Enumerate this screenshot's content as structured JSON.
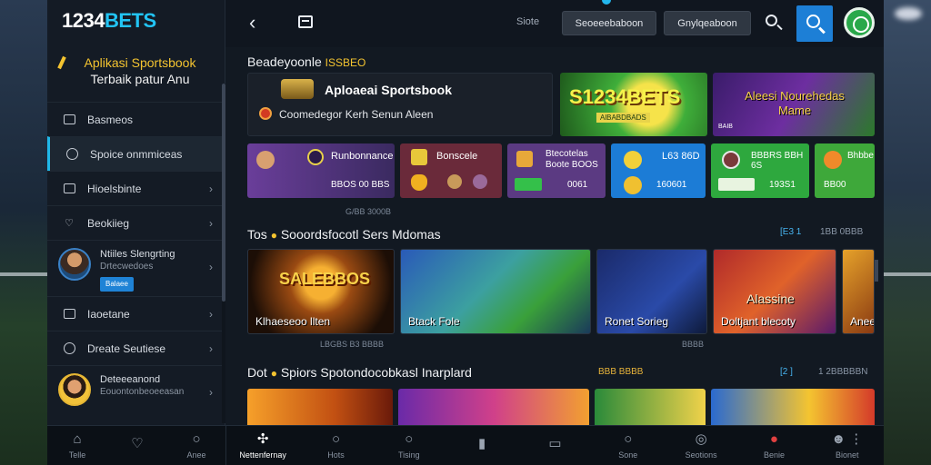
{
  "sidebar": {
    "logo_prefix": "1234",
    "logo_suffix": "BETS",
    "promo_line1": "Aplikasi Sportsbook",
    "promo_line2": "Terbaik patur Anu",
    "items": [
      {
        "label": "Basmeos"
      },
      {
        "label": "Spoice onmmiceas"
      },
      {
        "label": "Hioelsbinte"
      },
      {
        "label": "Beokiieg"
      }
    ],
    "user1": {
      "name": "Ntiiles Slengrting",
      "sub": "Drtecwedoes",
      "tag": "Balaee"
    },
    "items2": [
      {
        "label": "Iaoetane"
      },
      {
        "label": "Dreate Seutiese"
      }
    ],
    "user2": {
      "name": "Deteeeanond",
      "sub": "Eouontonbeoeeasan"
    }
  },
  "topbar": {
    "link": "Siote",
    "pill1": "Seoeeebaboon",
    "pill2": "Gnylqeaboon"
  },
  "main": {
    "section1": {
      "title": "Beadeyoonle",
      "badge": "ISSBEO"
    },
    "hero1": {
      "title": "Aploaeai Sportsbook",
      "subtitle": "Coomedegor Kerh Senun Aleen"
    },
    "hero2": {
      "title": "S1234BETS",
      "small": "AlBABDBADS"
    },
    "hero3": {
      "title": "Aleesi Nourehedas Mame",
      "small": "BAIB"
    },
    "tiles": [
      {
        "title": "Runbonnance",
        "value": "BBOS 00 BBS"
      },
      {
        "title": "Bonscele",
        "value": ""
      },
      {
        "title": "Btecotelas Boote BOOS",
        "value": "0061"
      },
      {
        "title": "L63 86D",
        "value": "160601"
      },
      {
        "title": "BBBRS BBH 6S",
        "value": "193S1"
      },
      {
        "title": "Bhbbe",
        "value": "BB00"
      }
    ],
    "under_tiles": "G/BB 3000B",
    "section2": {
      "title": "Tos",
      "title2": "Sooordsfocotl Sers Mdomas",
      "meta1": "[E3 1",
      "meta2": "1BB 0BBB"
    },
    "games": [
      {
        "label": "Klhaeseoo llten",
        "art": "SALEBBOS"
      },
      {
        "label": "Btack Fole"
      },
      {
        "label": "Ronet Sorieg"
      },
      {
        "label": "Doltjant blecoty",
        "art": "Alassine"
      },
      {
        "label": "Anee"
      }
    ],
    "under_games1": "LBGBS B3 BBBB",
    "under_games2": "BBBB",
    "section3": {
      "title": "Dot",
      "title2": "Spiors Spotondocobkasl Inarplard",
      "meta1": "BBB BBBB",
      "meta2": "[2 ]",
      "meta3": "1 2BBBBBN"
    }
  },
  "bottombar": {
    "left": [
      {
        "label": "Telle",
        "icon": "home-icon"
      },
      {
        "label": "",
        "icon": "heart-icon"
      },
      {
        "label": "Anee",
        "icon": "circle-icon"
      }
    ],
    "right": [
      {
        "label": "Nettenfernay",
        "icon": "puzzle-icon"
      },
      {
        "label": "Hots",
        "icon": "search-icon"
      },
      {
        "label": "Tising",
        "icon": "search-icon"
      },
      {
        "label": "",
        "icon": "book-icon"
      },
      {
        "label": "",
        "icon": "document-icon"
      },
      {
        "label": "Sone",
        "icon": "circle-icon"
      },
      {
        "label": "Seotions",
        "icon": "chat-icon"
      },
      {
        "label": "Benie",
        "icon": "record-icon"
      },
      {
        "label": "Bionet",
        "icon": "user-icon"
      }
    ]
  },
  "colors": {
    "accent": "#1d7fd6",
    "brand": "#22c4f4",
    "gold": "#f4c430",
    "profile": "#29a84a"
  }
}
